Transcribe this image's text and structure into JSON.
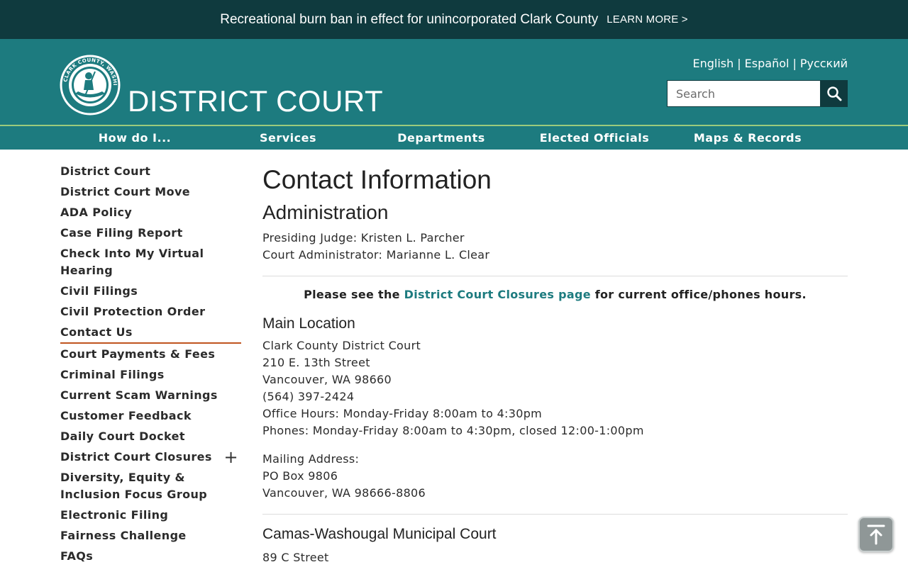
{
  "alert": {
    "text": "Recreational burn ban in effect for unincorporated Clark County",
    "link": "LEARN MORE >"
  },
  "header": {
    "seal_text": "CLARK COUNTY, WASHINGTON",
    "title": "DISTRICT COURT",
    "languages": [
      "English",
      "Español",
      "Русский"
    ],
    "search_placeholder": "Search"
  },
  "nav": {
    "items": [
      "How do I...",
      "Services",
      "Departments",
      "Elected Officials",
      "Maps & Records"
    ]
  },
  "sidebar": {
    "items": [
      "District Court",
      "District Court Move",
      "ADA Policy",
      "Case Filing Report",
      "Check Into My Virtual Hearing",
      "Civil Filings",
      "Civil Protection Order",
      "Contact Us",
      "Court Payments & Fees",
      "Criminal Filings",
      "Current Scam Warnings",
      "Customer Feedback",
      "Daily Court Docket",
      "District Court Closures",
      "Diversity, Equity & Inclusion Focus Group",
      "Electronic Filing",
      "Fairness Challenge",
      "FAQs"
    ],
    "expand_symbol": "+"
  },
  "main": {
    "title": "Contact Information",
    "admin_heading": "Administration",
    "presiding_judge": "Presiding Judge:  Kristen L. Parcher",
    "court_admin": "Court Administrator:  Marianne L. Clear",
    "notice_pre": "Please see the ",
    "notice_link": "District Court Closures page",
    "notice_post": " for current office/phones hours.",
    "main_location": {
      "heading": "Main Location",
      "lines": [
        "Clark County District Court",
        "210 E. 13th Street",
        "Vancouver, WA  98660",
        "(564) 397-2424",
        "Office Hours:  Monday-Friday 8:00am to 4:30pm",
        "Phones:  Monday-Friday 8:00am to 4:30pm, closed 12:00-1:00pm"
      ],
      "mailing": [
        "Mailing Address:",
        "PO Box 9806",
        "Vancouver, WA  98666-8806"
      ]
    },
    "camas": {
      "heading": "Camas-Washougal Municipal Court",
      "lines": [
        "89 C Street"
      ]
    }
  },
  "colors": {
    "alert_bg": "#0f3a3e",
    "header_bg": "#1d7b7f",
    "nav_border": "#9ccb7c",
    "link": "#1d7b7f",
    "active_underline": "#c0541f"
  },
  "icons": {
    "search": "search-icon",
    "scroll_top": "arrow-up-to-line-icon",
    "seal": "county-seal-icon"
  }
}
